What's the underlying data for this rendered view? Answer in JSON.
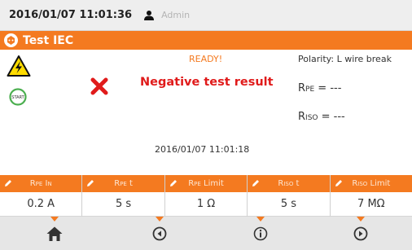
{
  "topbar": {
    "datetime": "2016/01/07 11:01:36",
    "user": "Admin"
  },
  "title": "Test IEC",
  "status": {
    "ready": "READY!",
    "polarity": "Polarity: L wire break",
    "result": "Negative test result"
  },
  "measurements": {
    "rpe": {
      "main": "R",
      "sub": "PE",
      "value": " = ---"
    },
    "riso": {
      "main": "R",
      "sub": "ISO",
      "value": " = ---"
    }
  },
  "timestamp": "2016/01/07 11:01:18",
  "params": [
    {
      "main": "R",
      "sub": "PE",
      "suffix": " I",
      "suffix_sub": "N",
      "value": "0.2 A"
    },
    {
      "main": "R",
      "sub": "PE",
      "suffix": " t",
      "suffix_sub": "",
      "value": "5 s"
    },
    {
      "main": "R",
      "sub": "PE",
      "suffix": " Limit",
      "suffix_sub": "",
      "value": "1 Ω"
    },
    {
      "main": "R",
      "sub": "ISO",
      "suffix": " t",
      "suffix_sub": "",
      "value": "5 s"
    },
    {
      "main": "R",
      "sub": "ISO",
      "suffix": " Limit",
      "suffix_sub": "",
      "value": "7 MΩ"
    }
  ],
  "start_icon_label": "START",
  "colors": {
    "accent": "#f47a20",
    "error": "#e01b1b",
    "bar_bg": "#e6e6e6"
  },
  "icons": {
    "user": "user-icon",
    "title": "iec-plug-icon",
    "warning": "high-voltage-warning-icon",
    "start": "start-icon",
    "result": "red-x-icon",
    "edit": "pencil-icon",
    "nav": [
      "home-icon",
      "back-icon",
      "info-icon",
      "forward-icon"
    ]
  }
}
